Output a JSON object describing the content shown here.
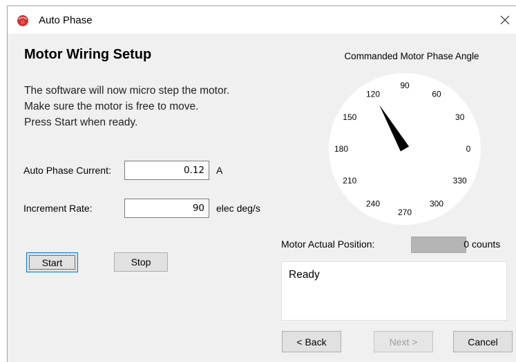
{
  "window": {
    "title": "Auto Phase",
    "close_glyph": "✕"
  },
  "heading": "Motor Wiring Setup",
  "instructions": [
    "The software will now micro step the motor.",
    "Make sure the motor is free to move.",
    "Press Start when ready."
  ],
  "fields": {
    "current": {
      "label": "Auto Phase Current:",
      "value": "0.12",
      "unit": "A"
    },
    "rate": {
      "label": "Increment Rate:",
      "value": "90",
      "unit": "elec deg/s"
    }
  },
  "buttons": {
    "start": "Start",
    "stop": "Stop",
    "back": "< Back",
    "next": "Next >",
    "cancel": "Cancel"
  },
  "dial": {
    "title": "Commanded Motor Phase Angle",
    "labels": [
      "0",
      "30",
      "60",
      "90",
      "120",
      "150",
      "180",
      "210",
      "240",
      "270",
      "300",
      "330"
    ],
    "angle_deg": 120,
    "needle_color": "#000000",
    "face_color": "#ffffff"
  },
  "position": {
    "label": "Motor Actual Position:",
    "value": "0",
    "unit": "counts"
  },
  "status": "Ready",
  "colors": {
    "icon_red": "#cc3333",
    "window_bg": "#f0f0f0",
    "focus_border": "#0078d7"
  }
}
